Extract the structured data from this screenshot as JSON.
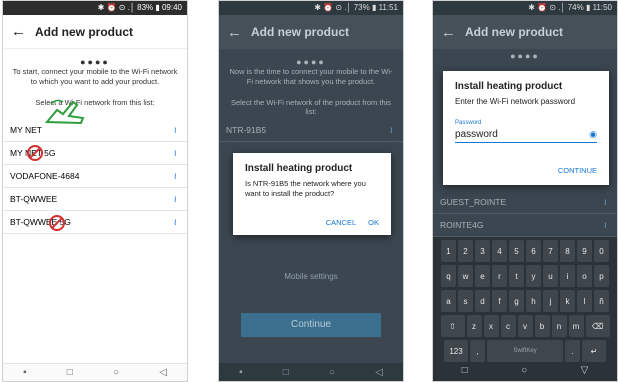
{
  "colors": {
    "accent": "#1976d2",
    "dim_background": "#3b4650",
    "stop_sign": "#d32f2f"
  },
  "phone1": {
    "status": "✱ ⏰ ⊙ .│ 83% ▮ 09:40",
    "title": "Add new product",
    "step_dots": "●●●●",
    "intro": "To start, connect your mobile to the Wi-Fi network to which you want to add your product.",
    "select_label": "Select a Wi-Fi network from this list:",
    "networks": [
      "MY NET",
      "MY NET 5G",
      "VODAFONE-4684",
      "BT-QWWEE",
      "BT-QWWEE 5G"
    ],
    "wifi_icon": "wifi-icon",
    "nav": [
      "▪",
      "□",
      "○",
      "◁"
    ]
  },
  "phone2": {
    "status": "✱ ⏰ ⊙ .│ 73% ▮ 11:51",
    "title": "Add new product",
    "step_dots": "●●●●",
    "intro": "Now is the time to connect your mobile to the Wi-Fi network that shows you the product.",
    "select_label": "Select the Wi-Fi network of the product from this list:",
    "network": "NTR-91B5",
    "dialog": {
      "title": "Install heating product",
      "message": "Is NTR-91B5 the network where you want to install the product?",
      "cancel": "CANCEL",
      "ok": "OK"
    },
    "mobile_settings": "Mobile settings",
    "continue": "Continue",
    "nav": [
      "▪",
      "□",
      "○",
      "◁"
    ]
  },
  "phone3": {
    "status": "✱ ⏰ ⊙ .│ 74% ▮ 11:50",
    "title": "Add new product",
    "step_dots": "●●●●",
    "dialog": {
      "title": "Install heating product",
      "subtitle": "Enter the Wi-Fi network password",
      "field_label": "Password",
      "field_value": "password",
      "continue": "CONTINUE"
    },
    "networks": [
      "GUEST_ROINTE",
      "ROINTE4G"
    ],
    "keyboard": {
      "row1": [
        "1",
        "2",
        "3",
        "4",
        "5",
        "6",
        "7",
        "8",
        "9",
        "0"
      ],
      "row2": [
        "q",
        "w",
        "e",
        "r",
        "t",
        "y",
        "u",
        "i",
        "o",
        "p"
      ],
      "row3": [
        "a",
        "s",
        "d",
        "f",
        "g",
        "h",
        "j",
        "k",
        "l",
        "ñ"
      ],
      "row4": [
        "⇧",
        "z",
        "x",
        "c",
        "v",
        "b",
        "n",
        "m",
        "⌫"
      ],
      "row5": [
        "123",
        ",",
        "SwiftKey",
        ".",
        "↵"
      ]
    },
    "nav": [
      "□",
      "○",
      "▽"
    ]
  }
}
